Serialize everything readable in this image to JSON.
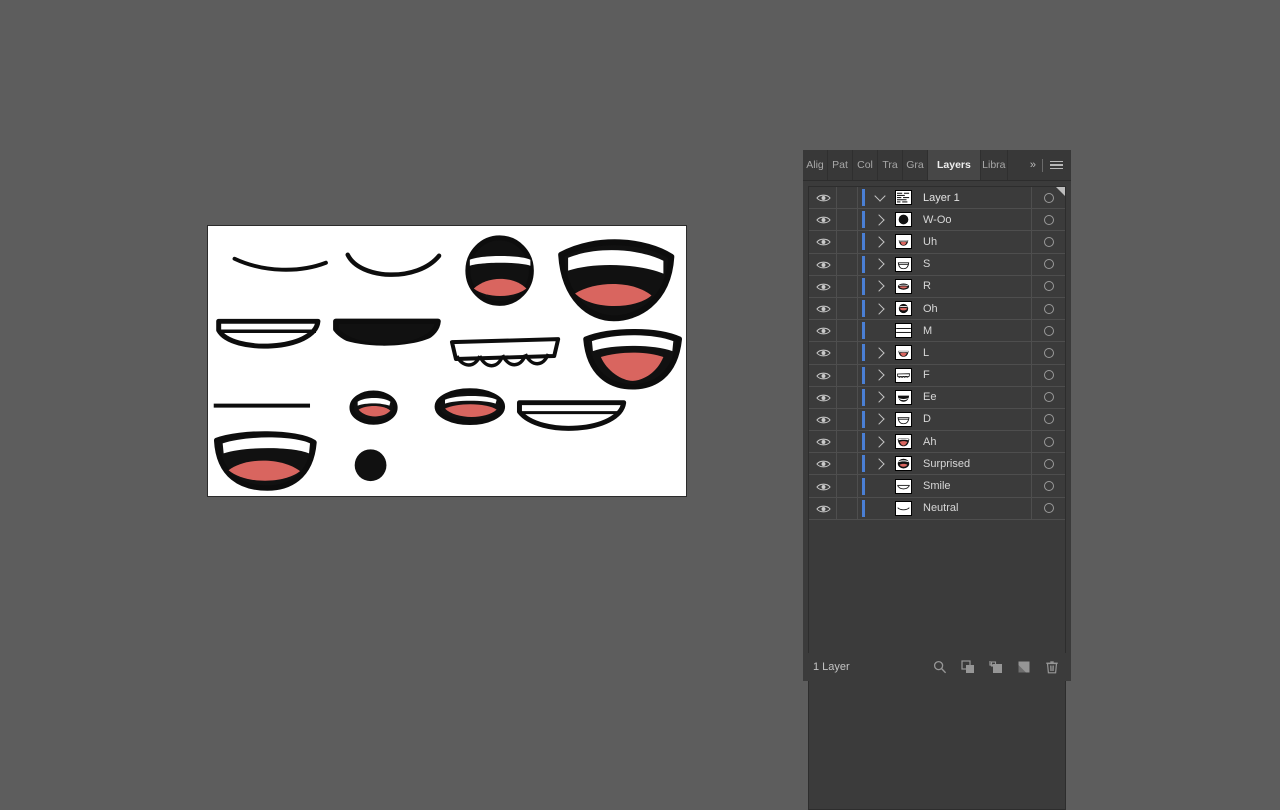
{
  "app": {
    "background_color": "#5d5d5d",
    "panel_color": "#3b3b3b",
    "accent_blue": "#4a7fd4",
    "lip_red": "#d9655f"
  },
  "artboard": {
    "name": "artboard",
    "background_color": "#ffffff",
    "border_color": "#2b2b2b",
    "shapes": [
      {
        "id": "neutral",
        "label": "Neutral"
      },
      {
        "id": "smile",
        "label": "Smile"
      },
      {
        "id": "surprised",
        "label": "Surprised"
      },
      {
        "id": "ah",
        "label": "Ah"
      },
      {
        "id": "d",
        "label": "D"
      },
      {
        "id": "ee",
        "label": "Ee"
      },
      {
        "id": "f",
        "label": "F"
      },
      {
        "id": "l",
        "label": "L"
      },
      {
        "id": "m",
        "label": "M"
      },
      {
        "id": "oh",
        "label": "Oh"
      },
      {
        "id": "r",
        "label": "R"
      },
      {
        "id": "s",
        "label": "S"
      },
      {
        "id": "uh",
        "label": "Uh"
      },
      {
        "id": "w-oo",
        "label": "W-Oo"
      }
    ]
  },
  "panel": {
    "tabs": [
      {
        "label": "Alig",
        "active": false
      },
      {
        "label": "Pat",
        "active": false
      },
      {
        "label": "Col",
        "active": false
      },
      {
        "label": "Tra",
        "active": false
      },
      {
        "label": "Gra",
        "active": false
      },
      {
        "label": "Layers",
        "active": true
      },
      {
        "label": "Libra",
        "active": false
      }
    ],
    "overflow_label": "»",
    "menu_icon": "hamburger-menu-icon",
    "status": {
      "count_label": "1 Layer",
      "buttons": [
        {
          "name": "locate-object-button",
          "icon": "magnifier-icon"
        },
        {
          "name": "make-clipping-mask-button",
          "icon": "clipping-mask-icon"
        },
        {
          "name": "create-new-sublayer-button",
          "icon": "new-sublayer-icon"
        },
        {
          "name": "create-new-layer-button",
          "icon": "new-layer-icon"
        },
        {
          "name": "delete-selection-button",
          "icon": "trash-icon"
        }
      ]
    },
    "rows": [
      {
        "name": "Layer 1",
        "top": true,
        "expandable": true,
        "expanded": true,
        "thumb": "layer1",
        "visible": true,
        "selected": true
      },
      {
        "name": "W-Oo",
        "top": false,
        "expandable": true,
        "expanded": false,
        "thumb": "woo",
        "visible": true,
        "selected": true
      },
      {
        "name": "Uh",
        "top": false,
        "expandable": true,
        "expanded": false,
        "thumb": "uh",
        "visible": true,
        "selected": true
      },
      {
        "name": "S",
        "top": false,
        "expandable": true,
        "expanded": false,
        "thumb": "s",
        "visible": true,
        "selected": true
      },
      {
        "name": "R",
        "top": false,
        "expandable": true,
        "expanded": false,
        "thumb": "r",
        "visible": true,
        "selected": true
      },
      {
        "name": "Oh",
        "top": false,
        "expandable": true,
        "expanded": false,
        "thumb": "oh",
        "visible": true,
        "selected": true
      },
      {
        "name": "M",
        "top": false,
        "expandable": false,
        "expanded": false,
        "thumb": "m",
        "visible": true,
        "selected": true
      },
      {
        "name": "L",
        "top": false,
        "expandable": true,
        "expanded": false,
        "thumb": "l",
        "visible": true,
        "selected": true
      },
      {
        "name": "F",
        "top": false,
        "expandable": true,
        "expanded": false,
        "thumb": "f",
        "visible": true,
        "selected": true
      },
      {
        "name": "Ee",
        "top": false,
        "expandable": true,
        "expanded": false,
        "thumb": "ee",
        "visible": true,
        "selected": true
      },
      {
        "name": "D",
        "top": false,
        "expandable": true,
        "expanded": false,
        "thumb": "d",
        "visible": true,
        "selected": true
      },
      {
        "name": "Ah",
        "top": false,
        "expandable": true,
        "expanded": false,
        "thumb": "ah",
        "visible": true,
        "selected": true
      },
      {
        "name": "Surprised",
        "top": false,
        "expandable": true,
        "expanded": false,
        "thumb": "surprised",
        "visible": true,
        "selected": true
      },
      {
        "name": "Smile",
        "top": false,
        "expandable": false,
        "expanded": false,
        "thumb": "smile",
        "visible": true,
        "selected": true
      },
      {
        "name": "Neutral",
        "top": false,
        "expandable": false,
        "expanded": false,
        "thumb": "neutral",
        "visible": true,
        "selected": true
      }
    ]
  }
}
